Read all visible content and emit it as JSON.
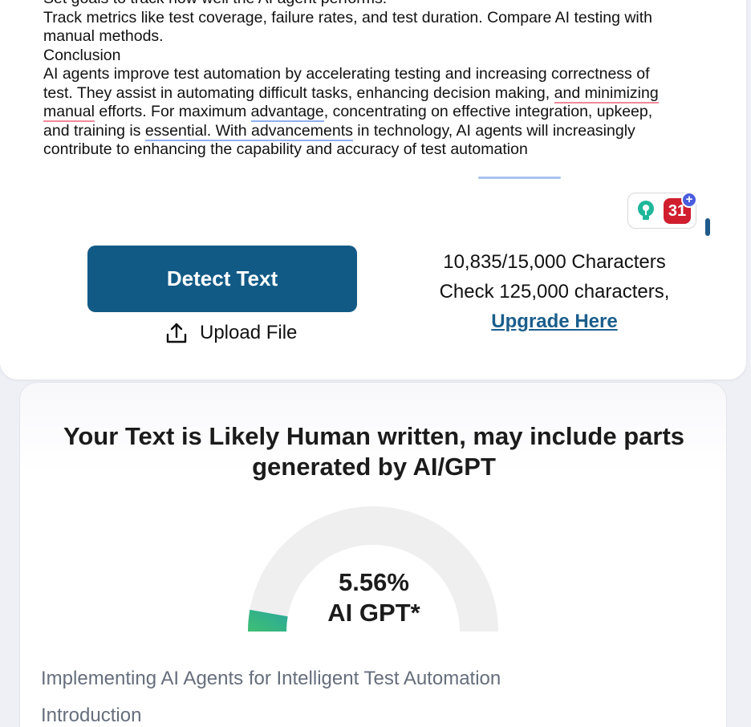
{
  "editor": {
    "lines": [
      [
        "Set goals to track how well the AI agent performs."
      ],
      [
        "Track metrics like test coverage, failure rates, and test duration. Compare AI testing with"
      ],
      [
        "manual methods."
      ],
      [
        "Conclusion"
      ],
      [
        "AI agents improve test automation by accelerating testing and increasing correctness of"
      ],
      [
        "test. They assist in automating difficult tasks, enhancing decision making, ",
        "and minimizing"
      ],
      [
        "manual",
        " efforts. For maximum ",
        "advantage",
        ", concentrating on effective integration, upkeep,"
      ],
      [
        "and training is ",
        "essential. With advancements",
        " in technology, AI agents will increasingly"
      ],
      [
        "contribute to enhancing the capability and accuracy of test automation"
      ]
    ]
  },
  "extension": {
    "badge_count": "31",
    "plus": "+"
  },
  "actions": {
    "detect_label": "Detect Text",
    "upload_label": "Upload File"
  },
  "usage": {
    "count": "10,835/15,000 Characters",
    "upsell": "Check 125,000 characters,",
    "upgrade_label": "Upgrade Here"
  },
  "result": {
    "title_line1": "Your Text is Likely Human written, may include parts",
    "title_line2": "generated by AI/GPT",
    "ai_percent": 5.56,
    "ai_percent_label": "5.56%",
    "ai_label": "AI GPT*",
    "gauge_colors": {
      "track": "#efefef",
      "fill_start": "#3fbf73",
      "fill_end": "#2aa79b"
    }
  },
  "analyzed_text": {
    "line1": "Implementing AI Agents for Intelligent Test Automation",
    "line2": "Introduction"
  }
}
